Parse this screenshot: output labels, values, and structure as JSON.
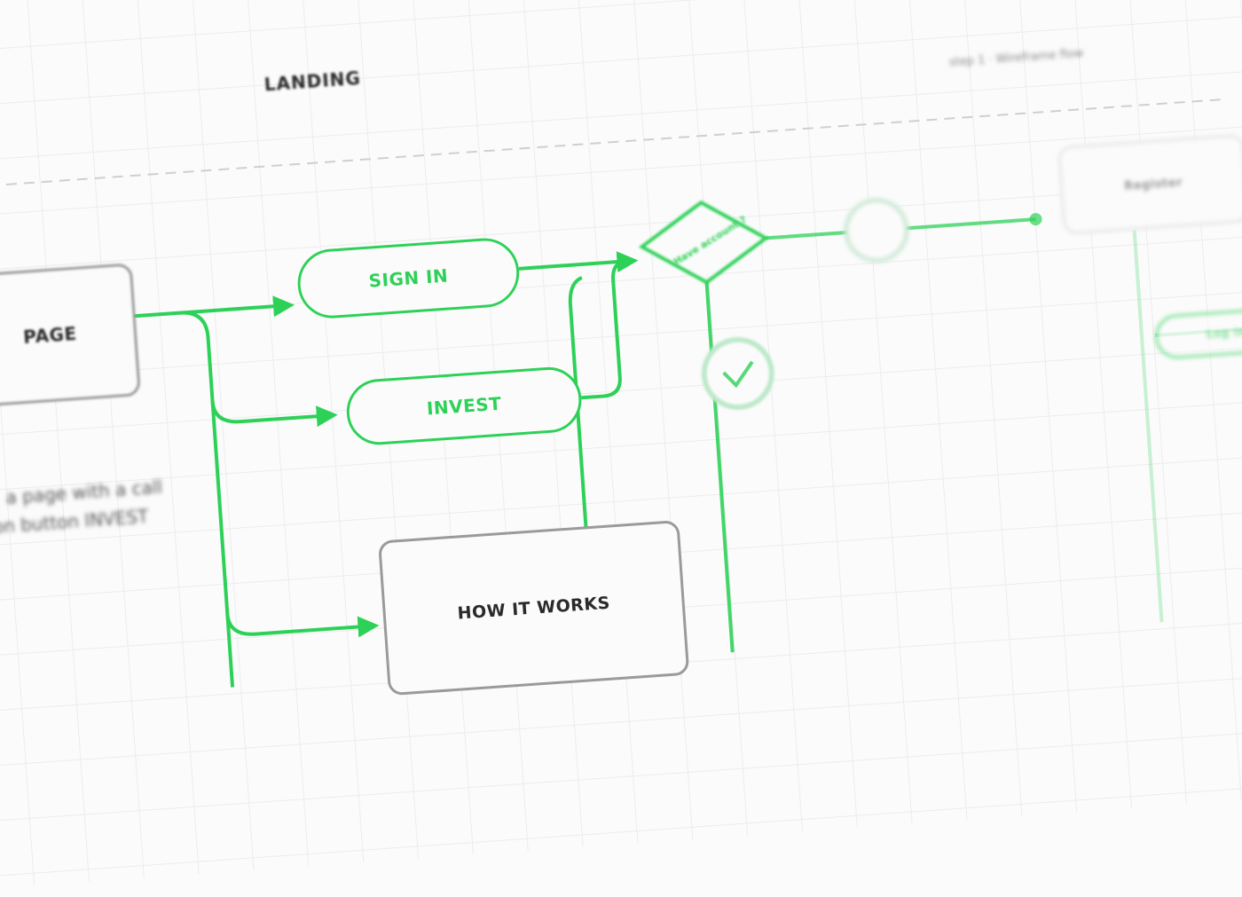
{
  "header": {
    "section_title": "LANDING",
    "right_caption": "step 1 · Wireframe flow"
  },
  "nodes": {
    "landing_page": "PAGE",
    "sign_in": "SIGN IN",
    "invest": "INVEST",
    "how_it_works": "HOW IT WORKS",
    "decision": "Have account ?",
    "right_box": "Register",
    "right_pill": "Log in"
  },
  "note": {
    "line1": "a page with a call",
    "line2": "to action button INVEST"
  },
  "colors": {
    "accent": "#2ed158",
    "box_border": "#9a9a9a",
    "grid": "#ececec",
    "background": "#fbfbfb",
    "text": "#2a2a2a"
  },
  "icons": {
    "yes_node": "check-icon",
    "no_node": "cross-icon"
  }
}
